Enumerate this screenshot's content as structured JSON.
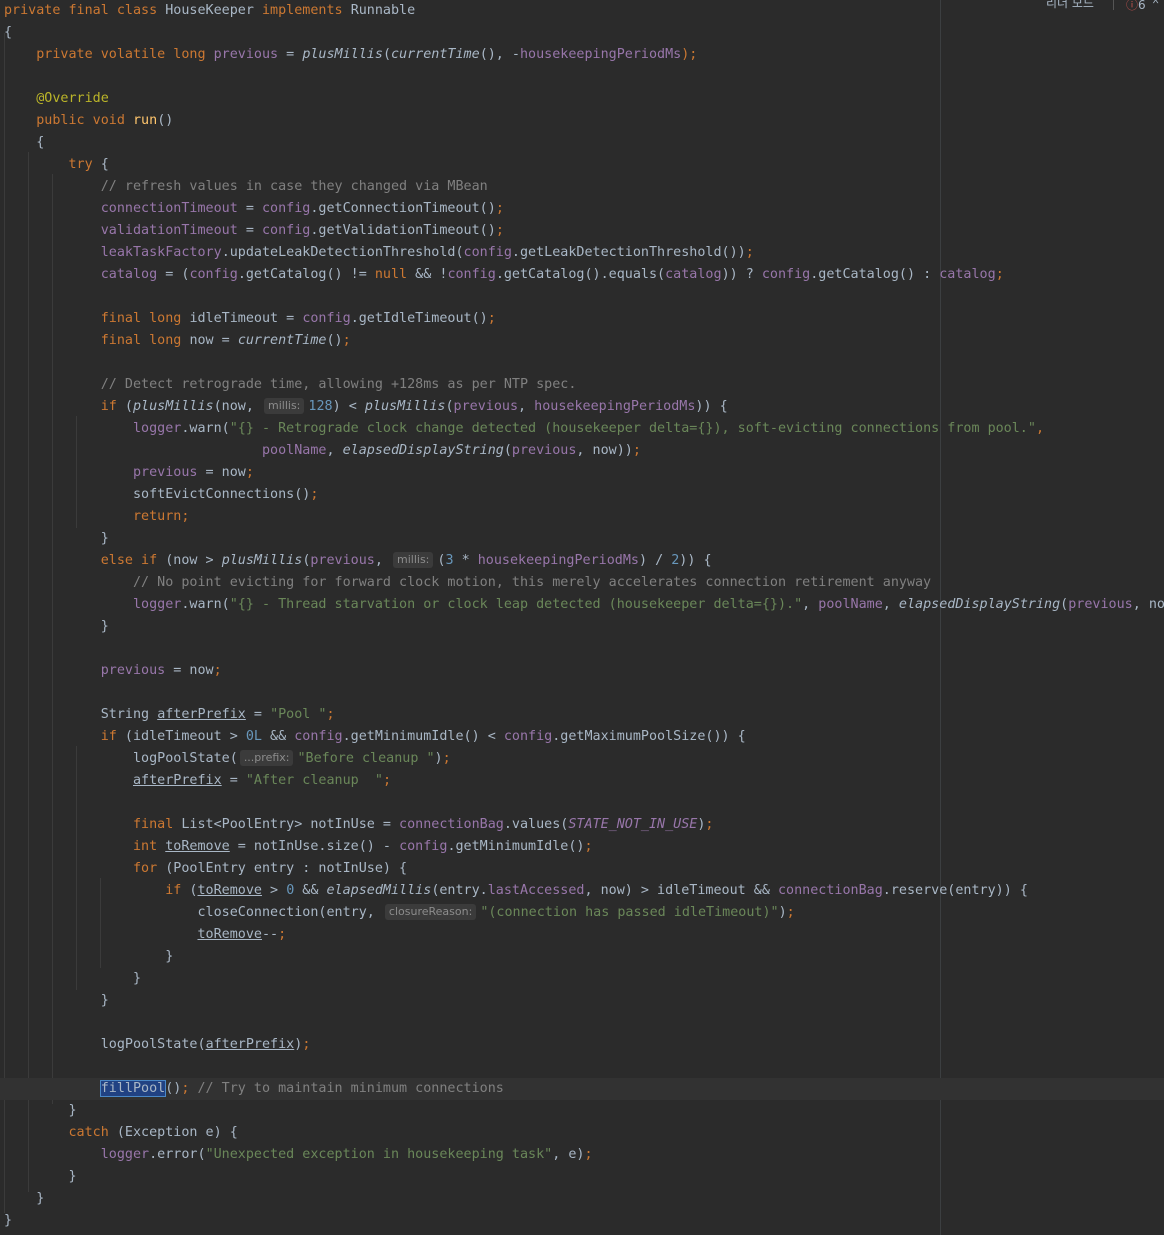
{
  "inspection": {
    "reader_mode_label": "리더 모드",
    "error_icon": "error-circle-icon",
    "error_icon_glyph": "ⓘ",
    "error_count": "6",
    "collapse_icon": "chevron-up-icon",
    "collapse_glyph": "⌃"
  },
  "code": {
    "class_decl": [
      "private",
      "final",
      "class",
      "HouseKeeper",
      "implements",
      "Runnable"
    ],
    "open_brace": "{",
    "close_brace": "}",
    "field_previous": {
      "mods": "private volatile long ",
      "name": "previous",
      "eq": " = ",
      "call": "plusMillis",
      "open": "(",
      "arg1": "currentTime",
      "arg1_tail": "(), -",
      "arg2": "housekeepingPeriodMs",
      "tail": ");"
    },
    "annotation": "@Override",
    "method_decl": {
      "mods": "public void ",
      "name": "run",
      "tail": "()"
    },
    "try_kw": "try",
    "try_tail": " {",
    "comment_refresh": "// refresh values in case they changed via MBean",
    "assign_conn": {
      "field": "connectionTimeout",
      "mid": " = ",
      "obj": "config",
      "call": ".getConnectionTimeout()",
      "semi": ";"
    },
    "assign_valid": {
      "field": "validationTimeout",
      "mid": " = ",
      "obj": "config",
      "call": ".getValidationTimeout()",
      "semi": ";"
    },
    "leak_line": {
      "field": "leakTaskFactory",
      "call1": ".updateLeakDetectionThreshold(",
      "obj": "config",
      "call2": ".getLeakDetectionThreshold())",
      "semi": ";"
    },
    "catalog_line": {
      "f1": "catalog",
      "p1": " = (",
      "o1": "config",
      "p2": ".getCatalog() != ",
      "kw_null": "null",
      "p3": " && !",
      "o2": "config",
      "p4": ".getCatalog().equals(",
      "f2": "catalog",
      "p5": ")) ? ",
      "o3": "config",
      "p6": ".getCatalog() : ",
      "f3": "catalog",
      "semi": ";"
    },
    "idle_line": {
      "kw": "final long ",
      "name": "idleTimeout",
      "mid": " = ",
      "obj": "config",
      "call": ".getIdleTimeout()",
      "semi": ";"
    },
    "now_line": {
      "kw": "final long ",
      "name": "now",
      "mid": " = ",
      "call": "currentTime",
      "tail": "()",
      "semi": ";"
    },
    "comment_retro": "// Detect retrograde time, allowing +128ms as per NTP spec.",
    "if_retro": {
      "kw": "if",
      "p1": " (",
      "call1": "plusMillis",
      "p2": "(now, ",
      "hint": "millis:",
      "num": "128",
      "p3": ") < ",
      "call2": "plusMillis",
      "p4": "(",
      "f1": "previous",
      "p5": ", ",
      "f2": "housekeepingPeriodMs",
      "p6": ")) {"
    },
    "warn1": {
      "field": "logger",
      "call": ".warn(",
      "str": "\"{} - Retrograde clock change detected (housekeeper delta={}), soft-evicting connections from pool.\"",
      "comma": ","
    },
    "warn1_cont": {
      "field": "poolName",
      "p1": ", ",
      "call": "elapsedDisplayString",
      "p2": "(",
      "f2": "previous",
      "p3": ", now))",
      "semi": ";"
    },
    "prev_assign": {
      "field": "previous",
      "tail": " = now",
      "semi": ";"
    },
    "soft_evict": {
      "call": "softEvictConnections()",
      "semi": ";"
    },
    "return_kw": "return",
    "semi": ";",
    "else_if": {
      "kw": "else if",
      "p1": " (now > ",
      "call": "plusMillis",
      "p2": "(",
      "f1": "previous",
      "p3": ", ",
      "hint": "millis:",
      "p4": "(",
      "num1": "3",
      "p5": " * ",
      "f2": "housekeepingPeriodMs",
      "p6": ") / ",
      "num2": "2",
      "p7": ")) {"
    },
    "comment_nopoint": "// No point evicting for forward clock motion, this merely accelerates connection retirement anyway",
    "warn2": {
      "field": "logger",
      "call": ".warn(",
      "str": "\"{} - Thread starvation or clock leap detected (housekeeper delta={}).\"",
      "p1": ", ",
      "f2": "poolName",
      "p2": ", ",
      "call2": "elapsedDisplayString",
      "p3": "(",
      "f3": "previous",
      "p4": ", now))",
      "semi": ";"
    },
    "string_after": {
      "type": "String ",
      "var": "afterPrefix",
      "mid": " = ",
      "str": "\"Pool \"",
      "semi": ";"
    },
    "if_idle": {
      "kw": "if",
      "p1": " (idleTimeout > ",
      "num": "0L",
      "p2": " && ",
      "o1": "config",
      "p3": ".getMinimumIdle() < ",
      "o2": "config",
      "p4": ".getMaximumPoolSize()) {"
    },
    "log_before": {
      "call": "logPoolState(",
      "hint": "...prefix:",
      "str": "\"Before cleanup \"",
      "tail": ")",
      "semi": ";"
    },
    "after_assign": {
      "var": "afterPrefix",
      "mid": " = ",
      "str": "\"After cleanup  \"",
      "semi": ";"
    },
    "not_in_use": {
      "kw": "final ",
      "type": "List<PoolEntry> notInUse = ",
      "field": "connectionBag",
      "call": ".values(",
      "cst": "STATE_NOT_IN_USE",
      "tail": ")",
      "semi": ";"
    },
    "to_remove": {
      "kw": "int ",
      "var": "toRemove",
      "mid": " = notInUse.size() - ",
      "obj": "config",
      "call": ".getMinimumIdle()",
      "semi": ";"
    },
    "for_line": {
      "kw": "for",
      "tail": " (PoolEntry entry : notInUse) {"
    },
    "if_remove": {
      "kw": "if",
      "p1": " (",
      "var": "toRemove",
      "p2": " > ",
      "num": "0",
      "p3": " && ",
      "call": "elapsedMillis",
      "p4": "(entry.",
      "f1": "lastAccessed",
      "p5": ", now) > idleTimeout && ",
      "f2": "connectionBag",
      "p6": ".reserve(entry)) {"
    },
    "close_conn": {
      "call": "closeConnection(entry, ",
      "hint": "closureReason:",
      "str": "\"(connection has passed idleTimeout)\"",
      "tail": ")",
      "semi": ";"
    },
    "decrement": {
      "var": "toRemove",
      "tail": "--",
      "semi": ";"
    },
    "log_after": {
      "call": "logPoolState(",
      "var": "afterPrefix",
      "tail": ")",
      "semi": ";"
    },
    "fill_pool": {
      "call": "fillPool",
      "tail": "()",
      "semi": ";",
      "comment": " // Try to maintain minimum connections"
    },
    "catch_line": {
      "kw": "catch",
      "tail": " (Exception e) {"
    },
    "log_error": {
      "field": "logger",
      "call": ".error(",
      "str": "\"Unexpected exception in housekeeping task\"",
      "tail": ", e)",
      "semi": ";"
    }
  }
}
